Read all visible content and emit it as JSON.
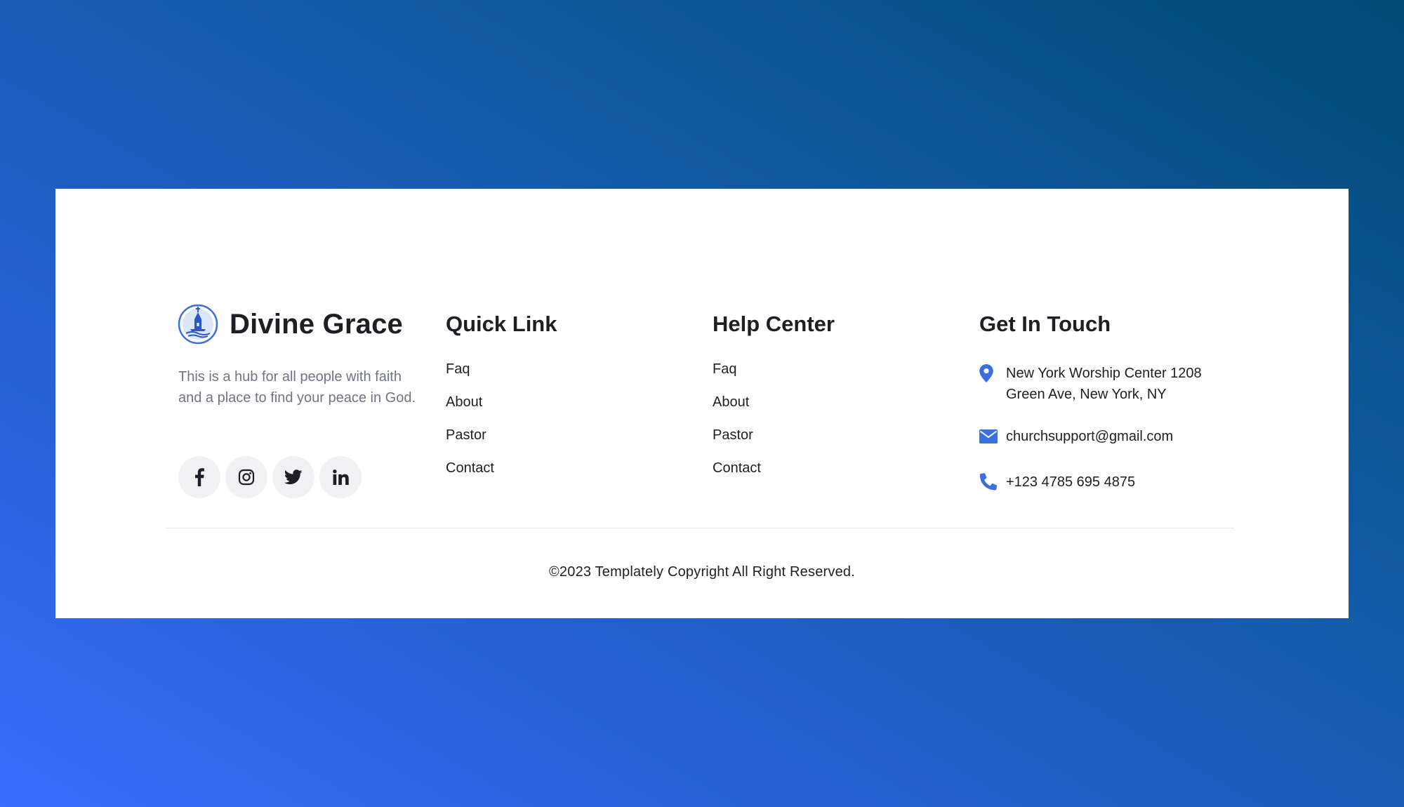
{
  "brand": {
    "name": "Divine Grace",
    "description": "This is a hub for all people with faith and a place to find your peace in God."
  },
  "socials": [
    {
      "icon": "facebook-icon"
    },
    {
      "icon": "instagram-icon"
    },
    {
      "icon": "twitter-icon"
    },
    {
      "icon": "linkedin-icon"
    }
  ],
  "quick_link": {
    "title": "Quick Link",
    "items": [
      "Faq",
      "About",
      "Pastor",
      "Contact"
    ]
  },
  "help_center": {
    "title": "Help Center",
    "items": [
      "Faq",
      "About",
      "Pastor",
      "Contact"
    ]
  },
  "get_in_touch": {
    "title": "Get In Touch",
    "address": "New York Worship Center 1208 Green Ave, New York, NY",
    "email": "churchsupport@gmail.com",
    "phone": "+123 4785 695 4875"
  },
  "copyright": "©2023 Templately Copyright All Right Reserved.",
  "colors": {
    "accent": "#3b6fe0",
    "text": "#1e1f26",
    "muted": "#707482",
    "social_bg": "#f1f1f3"
  }
}
